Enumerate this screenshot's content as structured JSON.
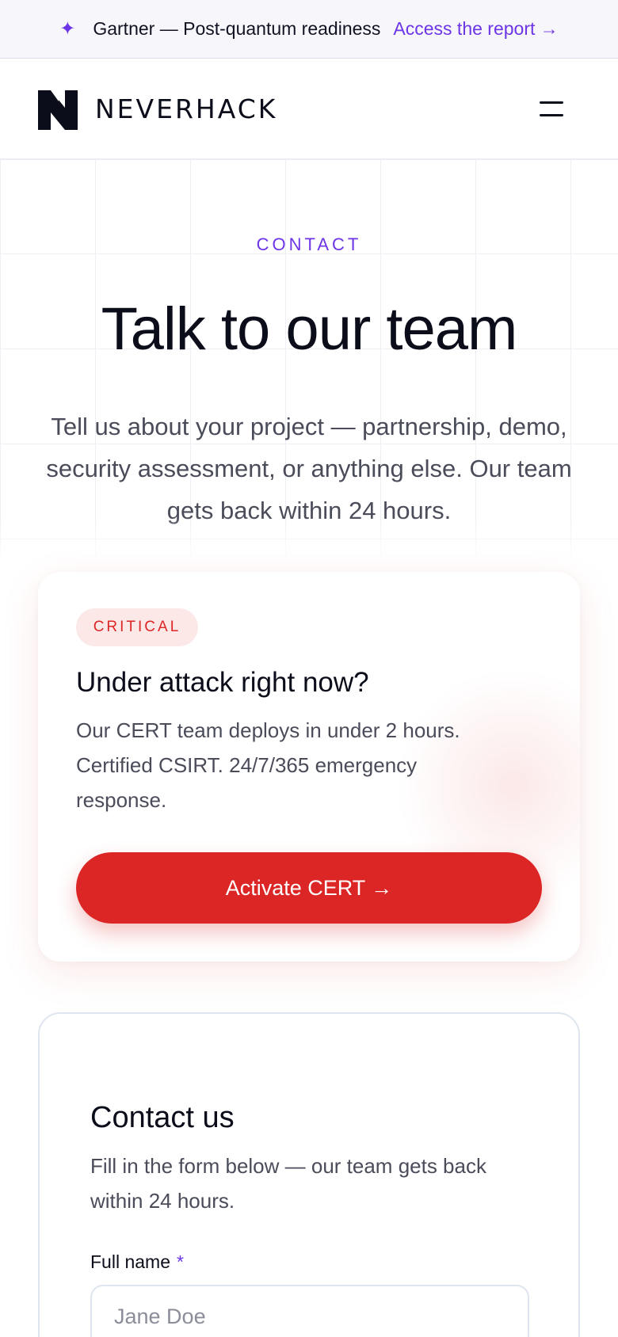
{
  "announcement": {
    "icon": "sparkle-icon",
    "text": "Gartner — Post-quantum readiness",
    "link_label": "Access the report →"
  },
  "header": {
    "brand": "NEVERHACK",
    "menu_icon": "hamburger-menu-icon"
  },
  "hero": {
    "eyebrow": "CONTACT",
    "title": "Talk to our team",
    "subtitle": "Tell us about your project — partnership, demo, security assessment, or anything else. Our team gets back within 24 hours."
  },
  "cert_card": {
    "badge": "CRITICAL",
    "title": "Under attack right now?",
    "description": "Our CERT team deploys in under 2 hours. Certified CSIRT. 24/7/365 emergency response.",
    "button_label": "Activate CERT →"
  },
  "contact_form": {
    "title": "Contact us",
    "subtitle": "Fill in the form below — our team gets back within 24 hours.",
    "fields": [
      {
        "label": "Full name",
        "required_marker": "*",
        "placeholder": "Jane Doe",
        "value": ""
      }
    ]
  },
  "colors": {
    "accent": "#6d35e6",
    "critical": "#dc2626",
    "critical_bg": "#fde8e8",
    "text": "#0b0d1a",
    "muted_text": "#4a4c5a"
  }
}
